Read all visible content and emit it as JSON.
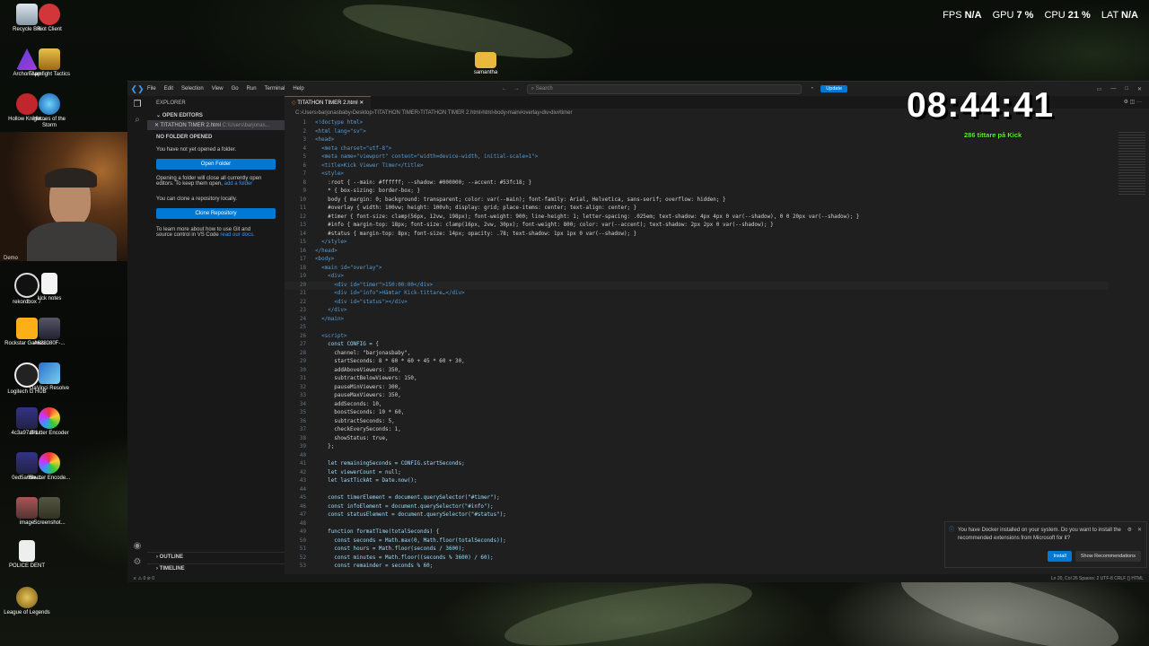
{
  "overlay_stats": {
    "fps_label": "FPS",
    "fps_value": "N/A",
    "gpu_label": "GPU",
    "gpu_value": "7 %",
    "cpu_label": "CPU",
    "cpu_value": "21 %",
    "lat_label": "LAT",
    "lat_value": "N/A"
  },
  "desktop_icons": [
    {
      "label": "Recycle Bin",
      "icon": "recycle-bin-icon"
    },
    {
      "label": "Riot Client",
      "icon": "riot-client-icon"
    },
    {
      "label": "Archon App",
      "icon": "archon-app-icon"
    },
    {
      "label": "Teamfight Tactics",
      "icon": "tft-icon"
    },
    {
      "label": "Hollow Knight...",
      "icon": "hollow-knight-icon"
    },
    {
      "label": "Heroes of the Storm",
      "icon": "heroes-storm-icon"
    },
    {
      "label": "rekordbox 7",
      "icon": "rekordbox-icon"
    },
    {
      "label": "kick notes",
      "icon": "text-file-icon"
    },
    {
      "label": "Rockstar Games...",
      "icon": "rockstar-icon"
    },
    {
      "label": "A628080F-...",
      "icon": "image-file-icon"
    },
    {
      "label": "Logitech G HUB",
      "icon": "logitech-icon"
    },
    {
      "label": "DaVinci Resolve",
      "icon": "davinci-icon"
    },
    {
      "label": "4c3a97af-1...",
      "icon": "image-file-icon"
    },
    {
      "label": "Shutter Encoder",
      "icon": "shutter-encoder-icon"
    },
    {
      "label": "0ed5a66e-...",
      "icon": "image-file-icon"
    },
    {
      "label": "Shutter Encode...",
      "icon": "shutter-encoder-icon"
    },
    {
      "label": "image",
      "icon": "image-file-icon"
    },
    {
      "label": "Screenshot...",
      "icon": "image-file-icon"
    },
    {
      "label": "POLICE DENT",
      "icon": "document-icon"
    },
    {
      "label": "League of Legends",
      "icon": "league-icon"
    },
    {
      "label": "samantha",
      "icon": "folder-icon"
    }
  ],
  "webcam_partial_label": "Demo",
  "vscode": {
    "menu": [
      "File",
      "Edit",
      "Selection",
      "View",
      "Go",
      "Run",
      "Terminal",
      "Help"
    ],
    "search_placeholder": "Search",
    "update_label": "Update",
    "sidebar": {
      "title": "EXPLORER",
      "open_editors": "OPEN EDITORS",
      "open_file": "TITATHON TIMER 2.html",
      "open_file_path": "C:\\Users\\barjonas...",
      "no_folder_header": "NO FOLDER OPENED",
      "no_folder_text": "You have not yet opened a folder.",
      "open_folder": "Open Folder",
      "close_text_1": "Opening a folder will close all currently open",
      "close_text_2": "editors. To keep them open,",
      "add_folder": "add a folder",
      "clone_text": "You can clone a repository locally.",
      "clone_button": "Clone Repository",
      "learn_text_1": "To learn more about how to use Git and",
      "learn_text_2": "source control in VS Code",
      "read_docs": "read our docs.",
      "outline": "OUTLINE",
      "timeline": "TIMELINE"
    },
    "tab": "TITATHON TIMER 2.html",
    "breadcrumbs": [
      "C:",
      "Users",
      "barjonasbaby",
      "Desktop",
      "TITATHON TIMER",
      "TITATHON TIMER 2.html",
      "html",
      "body",
      "main#overlay",
      "div",
      "div#timer"
    ],
    "code_lines": [
      "<!doctype html>",
      "<html lang=\"sv\">",
      "<head>",
      "  <meta charset=\"utf-8\">",
      "  <meta name=\"viewport\" content=\"width=device-width, initial-scale=1\">",
      "  <title>Kick Viewer Timer</title>",
      "  <style>",
      "    :root { --main: #ffffff; --shadow: #000000; --accent: #53fc18; }",
      "    * { box-sizing: border-box; }",
      "    body { margin: 0; background: transparent; color: var(--main); font-family: Arial, Helvetica, sans-serif; overflow: hidden; }",
      "    #overlay { width: 100vw; height: 100vh; display: grid; place-items: center; text-align: center; }",
      "    #timer { font-size: clamp(56px, 12vw, 198px); font-weight: 900; line-height: 1; letter-spacing: .025em; text-shadow: 4px 4px 0 var(--shadow), 0 0 20px var(--shadow); }",
      "    #info { margin-top: 18px; font-size: clamp(16px, 2vw, 30px); font-weight: 800; color: var(--accent); text-shadow: 2px 2px 0 var(--shadow); }",
      "    #status { margin-top: 8px; font-size: 14px; opacity: .78; text-shadow: 1px 1px 0 var(--shadow); }",
      "  </style>",
      "</head>",
      "<body>",
      "  <main id=\"overlay\">",
      "    <div>",
      "      <div id=\"timer\">150:00:00</div>",
      "      <div id=\"info\">Hämtar Kick-tittare…</div>",
      "      <div id=\"status\"></div>",
      "    </div>",
      "  </main>",
      "",
      "  <script>",
      "    const CONFIG = {",
      "      channel: \"barjonasbaby\",",
      "      startSeconds: 8 * 60 * 60 + 45 * 60 + 30,",
      "      addAboveViewers: 350,",
      "      subtractBelowViewers: 150,",
      "      pauseMinViewers: 300,",
      "      pauseMaxViewers: 350,",
      "      addSeconds: 10,",
      "      boostSeconds: 10 * 60,",
      "      subtractSeconds: 5,",
      "      checkEverySeconds: 1,",
      "      showStatus: true,",
      "    };",
      "",
      "    let remainingSeconds = CONFIG.startSeconds;",
      "    let viewerCount = null;",
      "    let lastTickAt = Date.now();",
      "",
      "    const timerElement = document.querySelector(\"#timer\");",
      "    const infoElement = document.querySelector(\"#info\");",
      "    const statusElement = document.querySelector(\"#status\");",
      "",
      "    function formatTime(totalSeconds) {",
      "      const seconds = Math.max(0, Math.floor(totalSeconds));",
      "      const hours = Math.floor(seconds / 3600);",
      "      const minutes = Math.floor((seconds % 3600) / 60);",
      "      const remainder = seconds % 60;"
    ],
    "current_line": 20,
    "status_right": "Ln 20, Col 26   Spaces: 2   UTF-8   CRLF   {} HTML",
    "notification": {
      "text": "You have Docker installed on your system. Do you want to install the recommended extensions from Microsoft for it?",
      "install": "Install",
      "show": "Show Recommendations"
    }
  },
  "timer_overlay": {
    "time": "08:44:41",
    "info": "286 tittare på Kick"
  }
}
